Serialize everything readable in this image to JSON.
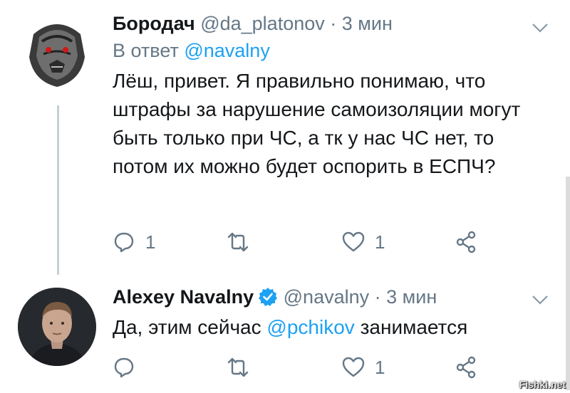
{
  "tweets": [
    {
      "name": "Бородач",
      "handle": "@da_platonov",
      "dot": "·",
      "time": "3 мин",
      "reply_prefix": "В ответ",
      "reply_handle": "@navalny",
      "text": "Лёш, привет. Я правильно понимаю, что штрафы за нарушение самоизоляции могут быть только при ЧС, а тк у нас ЧС нет, то потом их можно будет оспорить в ЕСПЧ?",
      "reply_count": "1",
      "like_count": "1"
    },
    {
      "name": "Alexey Navalny",
      "handle": "@navalny",
      "dot": "·",
      "time": "3 мин",
      "text_before": "Да, этим сейчас ",
      "mention": "@pchikov",
      "text_after": " занимается",
      "like_count": "1"
    }
  ],
  "icons": {
    "reply": "reply-icon",
    "retweet": "retweet-icon",
    "like": "heart-icon",
    "share": "share-icon",
    "more": "chevron-down-icon",
    "verified": "verified-badge-icon"
  },
  "colors": {
    "link": "#1da1f2",
    "muted": "#657786",
    "text": "#14171a"
  },
  "watermark": "Fishki.net"
}
